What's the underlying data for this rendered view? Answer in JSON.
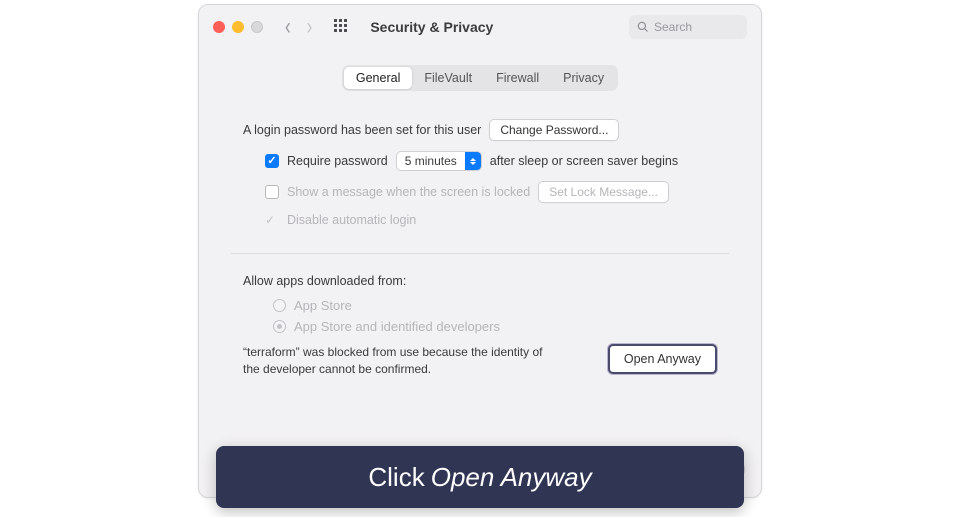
{
  "window": {
    "title": "Security & Privacy",
    "search_placeholder": "Search"
  },
  "tabs": {
    "general": "General",
    "filevault": "FileVault",
    "firewall": "Firewall",
    "privacy": "Privacy"
  },
  "login": {
    "password_set_text": "A login password has been set for this user",
    "change_password_btn": "Change Password...",
    "require_password_label": "Require password",
    "require_password_delay": "5 minutes",
    "require_password_suffix": "after sleep or screen saver begins",
    "show_message_label": "Show a message when the screen is locked",
    "set_lock_message_btn": "Set Lock Message...",
    "disable_auto_login_label": "Disable automatic login"
  },
  "allow_apps": {
    "heading": "Allow apps downloaded from:",
    "option_app_store": "App Store",
    "option_identified": "App Store and identified developers",
    "blocked_message": "“terraform” was blocked from use because the identity of the developer cannot be confirmed.",
    "open_anyway_btn": "Open Anyway"
  },
  "help": "?",
  "overlay": {
    "prefix": "Click ",
    "action": "Open Anyway"
  }
}
